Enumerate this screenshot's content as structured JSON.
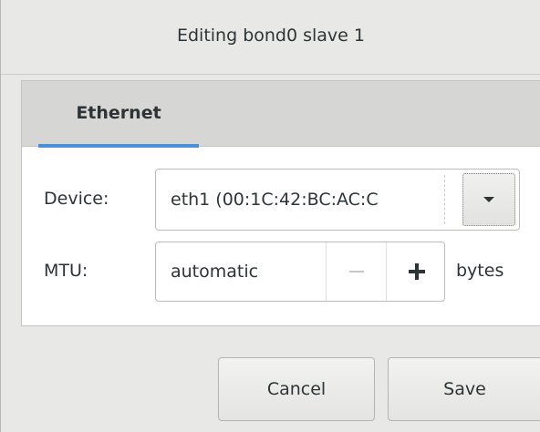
{
  "dialog": {
    "title": "Editing bond0 slave 1"
  },
  "tabs": [
    {
      "label": "Ethernet",
      "active": true
    }
  ],
  "form": {
    "device_label": "Device:",
    "device_value": "eth1 (00:1C:42:BC:AC:C",
    "mtu_label": "MTU:",
    "mtu_value": "automatic",
    "mtu_units": "bytes"
  },
  "buttons": {
    "cancel": "Cancel",
    "save": "Save"
  },
  "colors": {
    "accent": "#4a90d9",
    "background": "#e8e8e7",
    "panel": "#ffffff",
    "tab_bar": "#d6d6d4"
  },
  "icons": {
    "dropdown": "triangle-down-icon",
    "decrement": "minus-icon",
    "increment": "plus-icon"
  }
}
